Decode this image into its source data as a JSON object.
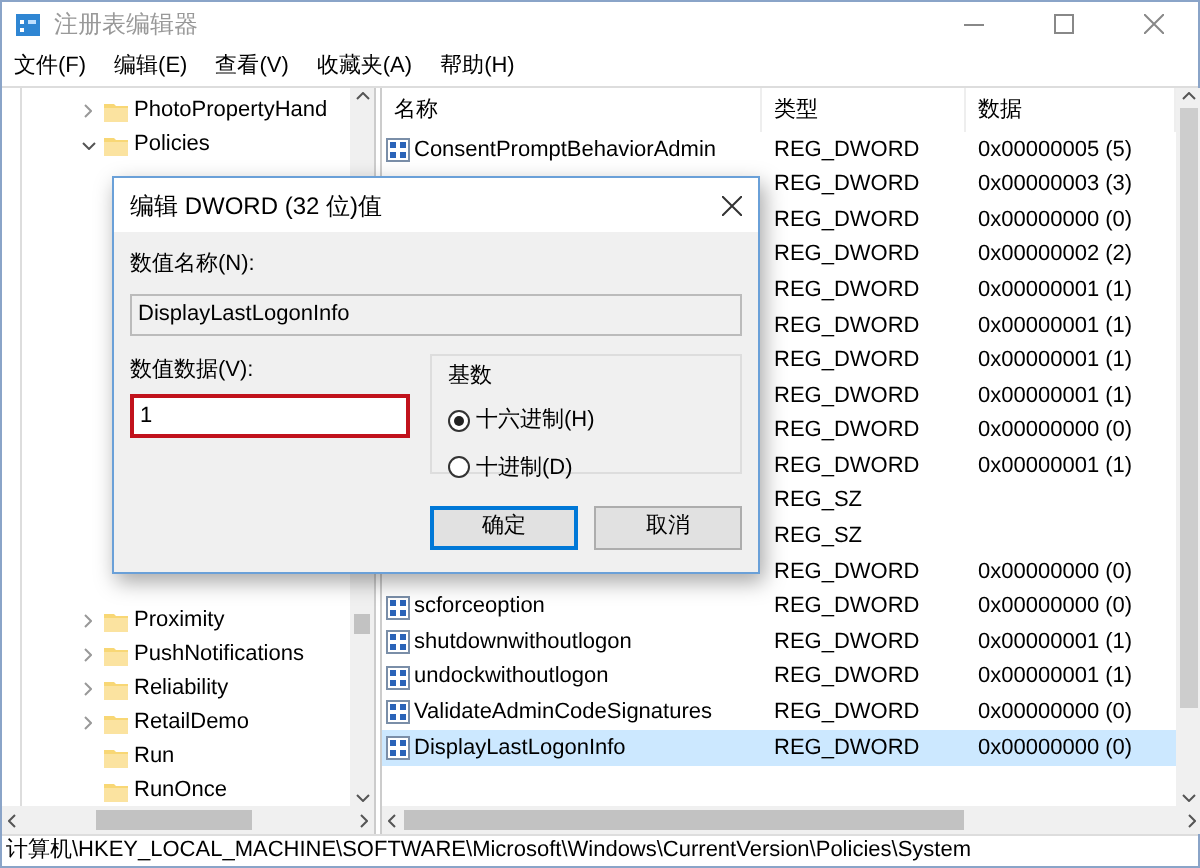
{
  "window": {
    "title": "注册表编辑器"
  },
  "menu": [
    "文件(F)",
    "编辑(E)",
    "查看(V)",
    "收藏夹(A)",
    "帮助(H)"
  ],
  "tree": [
    {
      "label": "PhotoPropertyHand",
      "expanded": false
    },
    {
      "label": "Policies",
      "expanded": true
    },
    {
      "label": "Proximity",
      "expanded": false
    },
    {
      "label": "PushNotifications",
      "expanded": false
    },
    {
      "label": "Reliability",
      "expanded": false
    },
    {
      "label": "RetailDemo",
      "expanded": false
    },
    {
      "label": "Run"
    },
    {
      "label": "RunOnce"
    }
  ],
  "table": {
    "columns": [
      "名称",
      "类型",
      "数据"
    ],
    "rows": [
      {
        "name": "ConsentPromptBehaviorAdmin",
        "type": "REG_DWORD",
        "data": "0x00000005 (5)",
        "selected": false
      },
      {
        "type": "REG_DWORD",
        "data": "0x00000003 (3)",
        "selected": false
      },
      {
        "type": "REG_DWORD",
        "data": "0x00000000 (0)",
        "selected": false
      },
      {
        "type": "REG_DWORD",
        "data": "0x00000002 (2)",
        "selected": false
      },
      {
        "type": "REG_DWORD",
        "data": "0x00000001 (1)",
        "selected": false
      },
      {
        "type": "REG_DWORD",
        "data": "0x00000001 (1)",
        "selected": false
      },
      {
        "type": "REG_DWORD",
        "data": "0x00000001 (1)",
        "selected": false
      },
      {
        "type": "REG_DWORD",
        "data": "0x00000001 (1)",
        "selected": false
      },
      {
        "type": "REG_DWORD",
        "data": "0x00000000 (0)",
        "selected": false
      },
      {
        "type": "REG_DWORD",
        "data": "0x00000001 (1)",
        "selected": false
      },
      {
        "type": "REG_SZ",
        "selected": false
      },
      {
        "type": "REG_SZ",
        "selected": false
      },
      {
        "type": "REG_DWORD",
        "data": "0x00000000 (0)",
        "selected": false
      },
      {
        "name": "scforceoption",
        "type": "REG_DWORD",
        "data": "0x00000000 (0)",
        "selected": false
      },
      {
        "name": "shutdownwithoutlogon",
        "type": "REG_DWORD",
        "data": "0x00000001 (1)",
        "selected": false
      },
      {
        "name": "undockwithoutlogon",
        "type": "REG_DWORD",
        "data": "0x00000001 (1)",
        "selected": false
      },
      {
        "name": "ValidateAdminCodeSignatures",
        "type": "REG_DWORD",
        "data": "0x00000000 (0)",
        "selected": false
      },
      {
        "name": "DisplayLastLogonInfo",
        "type": "REG_DWORD",
        "data": "0x00000000 (0)",
        "selected": true
      }
    ]
  },
  "status_bar": "计算机\\HKEY_LOCAL_MACHINE\\SOFTWARE\\Microsoft\\Windows\\CurrentVersion\\Policies\\System",
  "dialog": {
    "title": "编辑 DWORD (32 位)值",
    "name_label": "数值名称(N):",
    "name_value": "DisplayLastLogonInfo",
    "data_label": "数值数据(V):",
    "data_value": "1",
    "base_title": "基数",
    "base_options": [
      {
        "label": "十六进制(H)",
        "selected": true
      },
      {
        "label": "十进制(D)",
        "selected": false
      }
    ],
    "buttons": [
      {
        "label": "确定",
        "default": true
      },
      {
        "label": "取消",
        "default": false
      }
    ]
  }
}
